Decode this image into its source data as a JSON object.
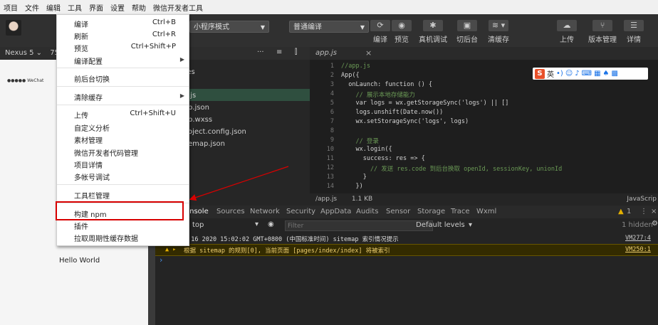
{
  "menubar": [
    "项目",
    "文件",
    "编辑",
    "工具",
    "界面",
    "设置",
    "帮助",
    "微信开发者工具"
  ],
  "toolbar": {
    "mode_select": "小程序模式",
    "compile_select": "普通编译",
    "tools": [
      {
        "label": "编译",
        "icon": "refresh-icon"
      },
      {
        "label": "预览",
        "icon": "eye-icon"
      },
      {
        "label": "真机调试",
        "icon": "bug-icon"
      },
      {
        "label": "切后台",
        "icon": "switch-icon"
      },
      {
        "label": "清缓存",
        "icon": "layers-icon"
      },
      {
        "label": "上传",
        "icon": "cloud-upload-icon"
      },
      {
        "label": "版本管理",
        "icon": "version-icon"
      },
      {
        "label": "详情",
        "icon": "menu-icon"
      }
    ]
  },
  "simulator": {
    "device": "Nexus 5",
    "zoom": "75%",
    "status": "●●●●● WeChat",
    "hello": "Hello World"
  },
  "filetree": {
    "items": [
      "ges",
      "s",
      ".js",
      "p.json",
      "p.wxss",
      "oject.config.json",
      "emap.json"
    ]
  },
  "editor": {
    "tab": "app.js",
    "status_file": "/app.js",
    "status_size": "1.1 KB",
    "status_lang": "JavaScrip",
    "lines": [
      "1",
      "2",
      "3",
      "4",
      "5",
      "6",
      "7",
      "8",
      "9",
      "10",
      "11",
      "12",
      "13",
      "14"
    ],
    "code": [
      "//app.js",
      "App({",
      "  onLaunch: function () {",
      "    // 展示本地存储能力",
      "    var logs = wx.getStorageSync('logs') || []",
      "    logs.unshift(Date.now())",
      "    wx.setStorageSync('logs', logs)",
      "",
      "    // 登录",
      "    wx.login({",
      "      success: res => {",
      "        // 发送 res.code 到后台换取 openId, sessionKey, unionId",
      "      }",
      "    })"
    ]
  },
  "ime": {
    "logo": "S",
    "lang": "英"
  },
  "devtools": {
    "tabs": [
      "onsole",
      "Sources",
      "Network",
      "Security",
      "AppData",
      "Audits",
      "Sensor",
      "Storage",
      "Trace",
      "Wxml"
    ],
    "warn_count": "1",
    "context": "top",
    "filter_placeholder": "Filter",
    "levels": "Default levels",
    "hidden": "1 hidden",
    "log1": "t 16 2020 15:02:02 GMT+0800 (中国标准时间) sitemap 索引情况提示",
    "log1_src": "VM277:4",
    "log2": "根据 sitemap 的规则[0], 当前页面 [pages/index/index] 将被索引",
    "log2_src": "VM250:1",
    "prompt": "›"
  },
  "menu": {
    "items": [
      {
        "label": "编译",
        "shortcut": "Ctrl+B"
      },
      {
        "label": "刷新",
        "shortcut": "Ctrl+R"
      },
      {
        "label": "预览",
        "shortcut": "Ctrl+Shift+P"
      },
      {
        "label": "编译配置",
        "shortcut": "",
        "submenu": "▶"
      },
      {
        "label": "前后台切换",
        "shortcut": ""
      },
      {
        "label": "清除缓存",
        "shortcut": "",
        "submenu": "▶"
      },
      {
        "label": "上传",
        "shortcut": "Ctrl+Shift+U"
      },
      {
        "label": "自定义分析",
        "shortcut": ""
      },
      {
        "label": "素材管理",
        "shortcut": ""
      },
      {
        "label": "微信开发者代码管理",
        "shortcut": ""
      },
      {
        "label": "项目详情",
        "shortcut": ""
      },
      {
        "label": "多帐号调试",
        "shortcut": ""
      },
      {
        "label": "工具栏管理",
        "shortcut": ""
      },
      {
        "label": "构建 npm",
        "shortcut": ""
      },
      {
        "label": "插件",
        "shortcut": ""
      },
      {
        "label": "拉取周期性缓存数据",
        "shortcut": ""
      }
    ]
  },
  "colors": {
    "highlight": "#d80000",
    "accent_green": "#2f4f3f"
  }
}
